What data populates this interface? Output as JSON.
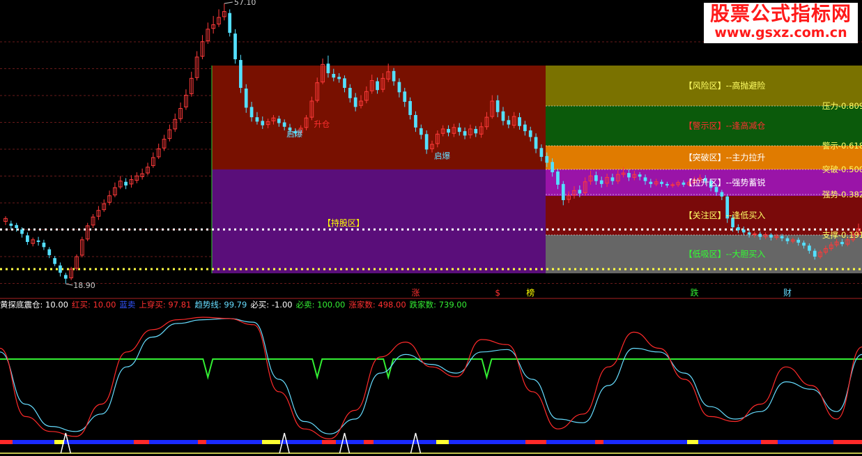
{
  "watermark": {
    "title": "股票公式指标网",
    "url": "www.gsxz.com.cn"
  },
  "indicator_bar": [
    {
      "label": "黄探底震仓:",
      "value": "10.00",
      "color": "#ffffff"
    },
    {
      "label": "红买:",
      "value": "10.00",
      "color": "#ff3030"
    },
    {
      "label": "蓝卖",
      "value": "",
      "color": "#3355ff"
    },
    {
      "label": "上穿买:",
      "value": "97.81",
      "color": "#ff3030"
    },
    {
      "label": "趋势线:",
      "value": "99.79",
      "color": "#66ddff"
    },
    {
      "label": "必买:",
      "value": "-1.00",
      "color": "#ffffff"
    },
    {
      "label": "必卖:",
      "value": "100.00",
      "color": "#33ee33"
    },
    {
      "label": "涨家数:",
      "value": "498.00",
      "color": "#ff3030"
    },
    {
      "label": "跌家数:",
      "value": "739.00",
      "color": "#33ee33"
    }
  ],
  "chart_data": [
    {
      "type": "candlestick",
      "price_range": [
        18.9,
        57.1
      ],
      "high_label": "57.10",
      "low_label": "18.90",
      "candles": [
        [
          27.4,
          27.8,
          28.1,
          26.9
        ],
        [
          27.1,
          26.8,
          27.5,
          26.3
        ],
        [
          26.9,
          26.5,
          27.2,
          26.0
        ],
        [
          26.3,
          25.7,
          26.6,
          25.2
        ],
        [
          25.5,
          24.6,
          25.9,
          24.2
        ],
        [
          24.4,
          24.9,
          25.2,
          24.0
        ],
        [
          24.8,
          24.6,
          25.3,
          24.1
        ],
        [
          24.5,
          23.9,
          24.9,
          23.5
        ],
        [
          23.6,
          22.8,
          23.9,
          22.4
        ],
        [
          22.4,
          21.6,
          22.7,
          21.3
        ],
        [
          21.4,
          20.4,
          21.8,
          19.9
        ],
        [
          20.1,
          19.6,
          20.4,
          18.9
        ],
        [
          19.7,
          20.9,
          21.2,
          19.4
        ],
        [
          21.0,
          22.6,
          22.9,
          20.7
        ],
        [
          22.8,
          24.9,
          25.3,
          22.5
        ],
        [
          25.0,
          26.8,
          27.2,
          24.7
        ],
        [
          26.9,
          28.0,
          28.4,
          26.5
        ],
        [
          28.1,
          28.9,
          29.5,
          27.6
        ],
        [
          29.0,
          29.8,
          30.4,
          28.7
        ],
        [
          30.0,
          30.9,
          31.6,
          29.6
        ],
        [
          31.0,
          32.0,
          32.7,
          30.7
        ],
        [
          32.1,
          32.9,
          33.6,
          31.8
        ],
        [
          32.8,
          32.3,
          33.3,
          31.8
        ],
        [
          32.5,
          33.1,
          33.7,
          32.0
        ],
        [
          33.0,
          33.6,
          34.1,
          32.6
        ],
        [
          33.5,
          33.9,
          34.6,
          33.1
        ],
        [
          34.0,
          34.8,
          35.4,
          33.7
        ],
        [
          35.0,
          36.1,
          36.8,
          34.7
        ],
        [
          36.2,
          37.3,
          38.0,
          35.9
        ],
        [
          37.4,
          38.6,
          39.2,
          37.0
        ],
        [
          38.7,
          39.9,
          40.6,
          38.3
        ],
        [
          40.0,
          41.3,
          42.1,
          39.6
        ],
        [
          41.4,
          42.8,
          43.6,
          41.0
        ],
        [
          43.0,
          44.6,
          45.4,
          42.6
        ],
        [
          44.8,
          46.9,
          47.8,
          44.4
        ],
        [
          47.0,
          49.8,
          50.6,
          46.6
        ],
        [
          49.9,
          51.9,
          52.8,
          49.5
        ],
        [
          52.0,
          53.6,
          54.5,
          51.6
        ],
        [
          53.7,
          54.2,
          55.4,
          53.0
        ],
        [
          54.3,
          55.2,
          56.3,
          53.9
        ],
        [
          55.3,
          56.0,
          57.1,
          54.8
        ],
        [
          55.8,
          53.1,
          56.3,
          52.6
        ],
        [
          53.0,
          49.5,
          53.6,
          48.9
        ],
        [
          49.4,
          45.6,
          50.1,
          44.9
        ],
        [
          45.5,
          42.9,
          46.1,
          42.2
        ],
        [
          43.0,
          41.6,
          43.7,
          41.0
        ],
        [
          41.6,
          41.0,
          42.3,
          40.6
        ],
        [
          41.1,
          40.5,
          41.7,
          40.0
        ],
        [
          40.6,
          41.0,
          41.4,
          40.1
        ],
        [
          41.1,
          41.5,
          41.9,
          40.6
        ],
        [
          41.4,
          40.8,
          41.8,
          40.3
        ],
        [
          40.9,
          40.3,
          41.3,
          39.8
        ],
        [
          40.2,
          39.8,
          40.7,
          39.3
        ],
        [
          39.7,
          39.4,
          40.1,
          38.9
        ],
        [
          39.5,
          40.1,
          40.5,
          39.1
        ],
        [
          40.2,
          41.5,
          41.9,
          39.8
        ],
        [
          41.6,
          43.8,
          44.4,
          41.2
        ],
        [
          43.9,
          46.3,
          47.0,
          43.6
        ],
        [
          46.4,
          48.8,
          49.6,
          46.1
        ],
        [
          48.9,
          47.6,
          50.0,
          47.0
        ],
        [
          47.5,
          47.0,
          48.2,
          46.5
        ],
        [
          47.1,
          46.8,
          47.6,
          46.3
        ],
        [
          46.9,
          45.6,
          47.3,
          45.0
        ],
        [
          45.6,
          44.2,
          46.1,
          43.6
        ],
        [
          44.3,
          43.0,
          44.9,
          42.4
        ],
        [
          43.2,
          43.8,
          44.6,
          42.8
        ],
        [
          43.9,
          45.1,
          45.8,
          43.5
        ],
        [
          45.2,
          46.6,
          47.4,
          44.8
        ],
        [
          46.5,
          45.3,
          47.0,
          44.8
        ],
        [
          45.4,
          46.9,
          47.6,
          45.0
        ],
        [
          46.8,
          47.8,
          48.9,
          46.4
        ],
        [
          47.9,
          46.5,
          48.3,
          45.9
        ],
        [
          46.4,
          45.0,
          46.9,
          44.3
        ],
        [
          45.1,
          43.7,
          45.6,
          43.0
        ],
        [
          43.8,
          41.9,
          44.3,
          41.3
        ],
        [
          41.9,
          40.2,
          42.4,
          39.6
        ],
        [
          40.1,
          39.2,
          40.6,
          38.6
        ],
        [
          39.3,
          37.2,
          39.8,
          36.6
        ],
        [
          37.3,
          37.9,
          38.4,
          36.8
        ],
        [
          38.0,
          39.3,
          39.8,
          37.5
        ],
        [
          39.4,
          40.0,
          40.5,
          39.0
        ],
        [
          40.0,
          39.5,
          40.5,
          39.0
        ],
        [
          39.4,
          40.2,
          40.7,
          38.9
        ],
        [
          40.2,
          39.6,
          40.8,
          39.1
        ],
        [
          39.7,
          39.1,
          40.2,
          38.6
        ],
        [
          39.2,
          40.0,
          40.6,
          38.7
        ],
        [
          40.0,
          39.4,
          40.4,
          38.9
        ],
        [
          39.3,
          40.3,
          40.9,
          38.8
        ],
        [
          40.3,
          41.6,
          42.3,
          39.9
        ],
        [
          41.7,
          43.8,
          44.6,
          41.4
        ],
        [
          43.9,
          42.3,
          44.6,
          41.6
        ],
        [
          42.4,
          41.1,
          43.0,
          40.5
        ],
        [
          41.2,
          40.6,
          41.8,
          40.1
        ],
        [
          40.5,
          41.7,
          42.3,
          40.1
        ],
        [
          41.6,
          40.4,
          42.2,
          39.9
        ],
        [
          40.6,
          39.7,
          41.1,
          39.1
        ],
        [
          39.8,
          38.9,
          40.3,
          38.3
        ],
        [
          38.9,
          37.3,
          39.4,
          36.7
        ],
        [
          37.4,
          36.2,
          37.9,
          35.6
        ],
        [
          36.3,
          35.4,
          36.8,
          34.8
        ],
        [
          35.5,
          34.1,
          36.0,
          33.5
        ],
        [
          34.2,
          32.4,
          34.6,
          31.8
        ],
        [
          32.5,
          30.3,
          32.9,
          29.6
        ],
        [
          30.4,
          30.9,
          31.5,
          29.9
        ],
        [
          31.0,
          31.6,
          32.2,
          30.5
        ],
        [
          31.7,
          31.2,
          32.3,
          30.7
        ],
        [
          31.3,
          32.8,
          33.4,
          30.9
        ],
        [
          32.9,
          33.6,
          34.3,
          32.4
        ],
        [
          33.7,
          32.9,
          34.2,
          32.4
        ],
        [
          33.0,
          32.5,
          33.5,
          32.0
        ],
        [
          32.6,
          33.4,
          33.9,
          32.1
        ],
        [
          33.4,
          32.9,
          33.9,
          32.4
        ],
        [
          32.9,
          33.8,
          34.4,
          32.5
        ],
        [
          33.8,
          34.0,
          34.8,
          33.4
        ],
        [
          34.0,
          33.4,
          34.5,
          32.9
        ],
        [
          33.4,
          33.8,
          34.3,
          33.0
        ],
        [
          33.8,
          33.5,
          34.1,
          33.0
        ],
        [
          33.4,
          32.9,
          33.8,
          32.4
        ],
        [
          32.8,
          32.5,
          33.2,
          32.0
        ],
        [
          32.5,
          32.8,
          33.2,
          32.2
        ],
        [
          32.8,
          32.5,
          33.1,
          32.1
        ],
        [
          32.5,
          32.3,
          32.8,
          32.0
        ],
        [
          32.3,
          32.4,
          32.7,
          32.0
        ],
        [
          32.4,
          32.7,
          33.0,
          32.1
        ],
        [
          32.7,
          32.4,
          33.0,
          32.1
        ],
        [
          32.4,
          32.7,
          33.0,
          32.2
        ],
        [
          32.7,
          33.1,
          33.5,
          32.4
        ],
        [
          33.0,
          33.3,
          33.8,
          32.7
        ],
        [
          33.3,
          32.9,
          33.7,
          32.4
        ],
        [
          32.9,
          32.0,
          33.2,
          31.5
        ],
        [
          32.1,
          31.4,
          32.5,
          30.9
        ],
        [
          31.4,
          30.8,
          31.7,
          30.3
        ],
        [
          30.8,
          27.8,
          31.0,
          27.2
        ],
        [
          27.9,
          26.6,
          28.3,
          26.0
        ],
        [
          26.6,
          26.2,
          27.0,
          25.8
        ],
        [
          26.3,
          25.9,
          26.7,
          25.5
        ],
        [
          25.9,
          25.6,
          26.3,
          25.2
        ],
        [
          25.6,
          25.7,
          26.0,
          25.2
        ],
        [
          25.7,
          25.3,
          26.0,
          24.9
        ],
        [
          25.3,
          25.6,
          25.9,
          25.0
        ],
        [
          25.6,
          25.2,
          25.8,
          24.8
        ],
        [
          25.2,
          25.4,
          25.7,
          24.9
        ],
        [
          25.4,
          25.1,
          25.7,
          24.7
        ],
        [
          25.1,
          24.7,
          25.4,
          24.3
        ],
        [
          24.7,
          24.9,
          25.2,
          24.4
        ],
        [
          24.9,
          24.5,
          25.2,
          24.1
        ],
        [
          24.5,
          24.1,
          24.8,
          23.7
        ],
        [
          24.1,
          23.4,
          24.4,
          23.0
        ],
        [
          23.4,
          22.6,
          23.7,
          22.2
        ],
        [
          22.6,
          23.2,
          23.5,
          22.3
        ],
        [
          23.2,
          23.7,
          24.1,
          22.9
        ],
        [
          23.7,
          24.2,
          24.6,
          23.4
        ],
        [
          24.2,
          24.6,
          25.0,
          23.9
        ],
        [
          24.6,
          24.3,
          25.0,
          24.0
        ],
        [
          24.3,
          24.9,
          25.3,
          24.0
        ],
        [
          24.9,
          25.6,
          26.1,
          24.6
        ],
        [
          25.6,
          26.4,
          27.1,
          25.3
        ]
      ],
      "zones": {
        "hold_zone": {
          "label": "【持股区】",
          "price_range": [
            20.9,
            48.8
          ],
          "split_price": 40.3
        },
        "levels": [
          {
            "label": "【风险区】--高抛避险",
            "tag": "压力",
            "ratio": "0.809"
          },
          {
            "label": "【警示区】--逢高减仓",
            "tag": "警示",
            "ratio": "0.618"
          },
          {
            "label": "【突破区】--主力拉升",
            "tag": "突破",
            "ratio": "0.500"
          },
          {
            "label": "【拉升区】--强势蓄锐",
            "tag": "强势",
            "ratio": "0.382"
          },
          {
            "label": "【关注区】--逢低买入",
            "tag": "关注",
            "ratio": ""
          },
          {
            "label": "【低吸区】--大胆买入",
            "tag": "支撑",
            "ratio": "0.191"
          }
        ]
      },
      "annotations": [
        {
          "text": "启爆",
          "at": 51
        },
        {
          "text": "启爆",
          "at": 78
        },
        {
          "text": "升仓",
          "at": 56
        }
      ],
      "markers": [
        {
          "text": "涨",
          "at": 75,
          "color": "#ff3030"
        },
        {
          "text": "$",
          "at": 90,
          "color": "#ff3030"
        },
        {
          "text": "榜",
          "at": 96,
          "color": "#ffff00"
        },
        {
          "text": "跌",
          "at": 126,
          "color": "#33ee33"
        },
        {
          "text": "财",
          "at": 143,
          "color": "#66ddff"
        }
      ],
      "dotted_lines": [
        {
          "price": 26.3,
          "color": "#ffffff"
        },
        {
          "price": 20.9,
          "color": "#ffff44"
        }
      ]
    },
    {
      "type": "line",
      "ylim": [
        0,
        100
      ],
      "x": [
        0,
        5,
        10,
        15,
        20,
        25,
        30,
        35,
        40,
        45,
        50,
        55,
        60,
        65,
        70,
        75,
        80,
        85,
        90,
        95,
        100,
        105,
        110,
        115,
        120,
        125,
        130,
        135,
        140,
        145,
        150,
        155,
        160,
        165,
        170
      ],
      "series": [
        {
          "color": "#ff2a2a",
          "values": [
            75,
            20,
            8,
            4,
            30,
            72,
            90,
            98,
            100,
            99,
            94,
            40,
            10,
            2,
            25,
            68,
            80,
            60,
            52,
            82,
            78,
            40,
            10,
            22,
            60,
            88,
            75,
            50,
            20,
            16,
            30,
            60,
            45,
            18,
            76
          ]
        },
        {
          "color": "#66ddff",
          "values": [
            72,
            30,
            12,
            8,
            22,
            60,
            84,
            95,
            98,
            99,
            96,
            50,
            16,
            6,
            18,
            55,
            70,
            62,
            55,
            72,
            74,
            50,
            18,
            15,
            45,
            75,
            72,
            55,
            28,
            18,
            24,
            48,
            42,
            24,
            70
          ]
        },
        {
          "color": "#33ee33",
          "values": [
            100,
            100,
            100,
            100,
            100,
            100,
            100,
            100,
            100,
            100,
            100,
            100,
            100,
            100,
            100,
            100,
            100,
            100,
            100,
            100,
            100,
            100,
            100,
            100,
            100,
            100,
            100,
            100,
            100,
            100,
            100,
            100,
            100,
            100,
            100
          ]
        }
      ],
      "dips": [
        37,
        57,
        70,
        88
      ],
      "triangles": [
        11,
        51,
        62,
        75,
        163
      ]
    }
  ]
}
